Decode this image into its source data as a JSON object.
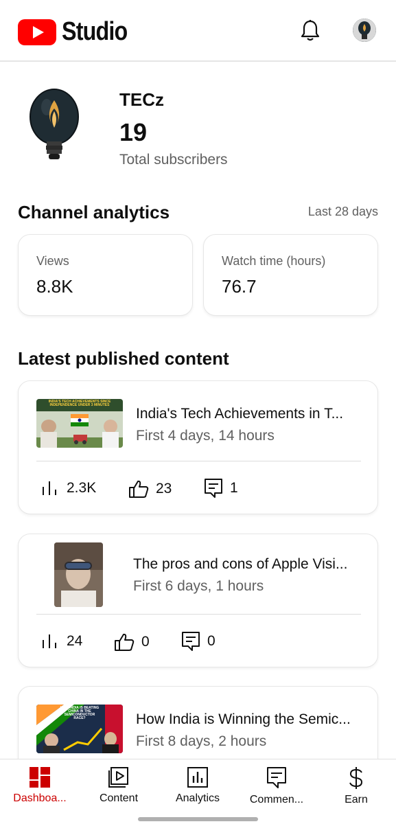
{
  "app": {
    "logo_text": "Studio"
  },
  "header": {
    "notifications_icon": "bell-icon",
    "account_icon": "avatar"
  },
  "channel": {
    "name": "TECz",
    "subscriber_count": "19",
    "subscriber_label": "Total subscribers"
  },
  "analytics": {
    "title": "Channel analytics",
    "range": "Last 28 days",
    "cards": [
      {
        "label": "Views",
        "value": "8.8K"
      },
      {
        "label": "Watch time (hours)",
        "value": "76.7"
      }
    ]
  },
  "latest": {
    "title": "Latest published content",
    "videos": [
      {
        "title": "India's Tech Achievements in T...",
        "meta": "First 4 days, 14 hours",
        "thumb_caption": "INDIA'S TECH ACHIEVEMENTS SINCE INDEPENDENCE UNDER 3 MINUTES",
        "views": "2.3K",
        "likes": "23",
        "comments": "1"
      },
      {
        "title": "The pros and cons of Apple Visi...",
        "meta": "First 6 days, 1 hours",
        "views": "24",
        "likes": "0",
        "comments": "0"
      },
      {
        "title": "How India is Winning the Semic...",
        "meta": "First 8 days, 2 hours",
        "thumb_caption": "HOW INDIA IS BEATING CHINA IN THE SEMICONDUCTOR RACE?"
      }
    ]
  },
  "nav": {
    "items": [
      {
        "label": "Dashboa...",
        "icon": "dashboard-icon",
        "active": true
      },
      {
        "label": "Content",
        "icon": "content-icon",
        "active": false
      },
      {
        "label": "Analytics",
        "icon": "analytics-icon",
        "active": false
      },
      {
        "label": "Commen...",
        "icon": "comments-icon",
        "active": false
      },
      {
        "label": "Earn",
        "icon": "dollar-icon",
        "active": false
      }
    ]
  },
  "colors": {
    "brand_red": "#ff0000",
    "active_nav": "#cc0000",
    "secondary_text": "#606060"
  }
}
